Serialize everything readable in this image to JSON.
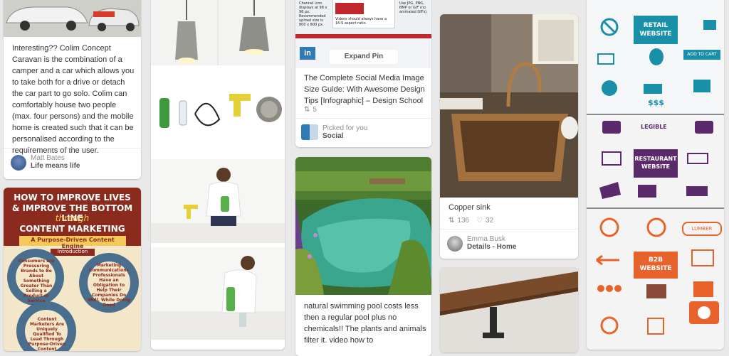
{
  "colimPin": {
    "description": "Interesting?? Colim Concept Caravan is the combination of a camper and a car which allows you to take both for a drive or detach the car part to go solo. Colim can comfortably house two people (max. four persons) and the mobile home is created such that it can be personalised according to the requirements of the user.",
    "user": "Matt Bates",
    "board": "Life means life"
  },
  "contentMarketingPin": {
    "title_line1": "HOW TO IMPROVE LIVES",
    "title_line2": "& IMPROVE THE BOTTOM LINE",
    "title_line3": "through",
    "title_line4": "CONTENT MARKETING",
    "subtitle": "A Purpose-Driven Content Engine",
    "intro": "Introduction",
    "gear1": "Consumers are Pressuring Brands to Be About Something Greater Than Selling a Product or Service",
    "gear2": "Marketing Communications Professionals Have an Obligation to Help Their Companies Do Well, While Doing Good",
    "gear3": "Content Marketers Are Uniquely Qualified To Lead Through Purpose-Driven Content"
  },
  "socialPin": {
    "expand_label": "Expand Pin",
    "title": "The Complete Social Media Image Size Guide: With Awesome Design Tips [Infographic] – Design School",
    "repins": "5",
    "picked_label": "Picked for you",
    "board": "Social",
    "mini_text1": "Channel icon displays at 98 x 98 px. Recommended upload size is 800 x 800 px.",
    "mini_text2": "Videos should always have a 16:9 aspect ratio.",
    "mini_text3": "Use JPG, PNG, BMP or GIF (no animated GIFs)."
  },
  "poolPin": {
    "description": "natural swimming pool costs less then a regular pool plus no chemicals!! The plants and animals filter it. video how to"
  },
  "sinkPin": {
    "title": "Copper sink",
    "repins": "136",
    "likes": "32",
    "user": "Emma Busk",
    "board": "Details - Home"
  },
  "infographic": {
    "retail": "RETAIL WEBSITE",
    "restaurant": "RESTAURANT WEBSITE",
    "b2b": "B2B WEBSITE",
    "add_to_cart": "ADD TO CART",
    "legible": "LEGIBLE",
    "lumber": "LUMBER",
    "price": "$$$"
  },
  "colors": {
    "background": "#e9e9e9",
    "card": "#ffffff",
    "teal": "#1a8fa8",
    "purple": "#5b2a6b",
    "orange": "#e8632b",
    "pinterest_red": "#bd081c"
  }
}
